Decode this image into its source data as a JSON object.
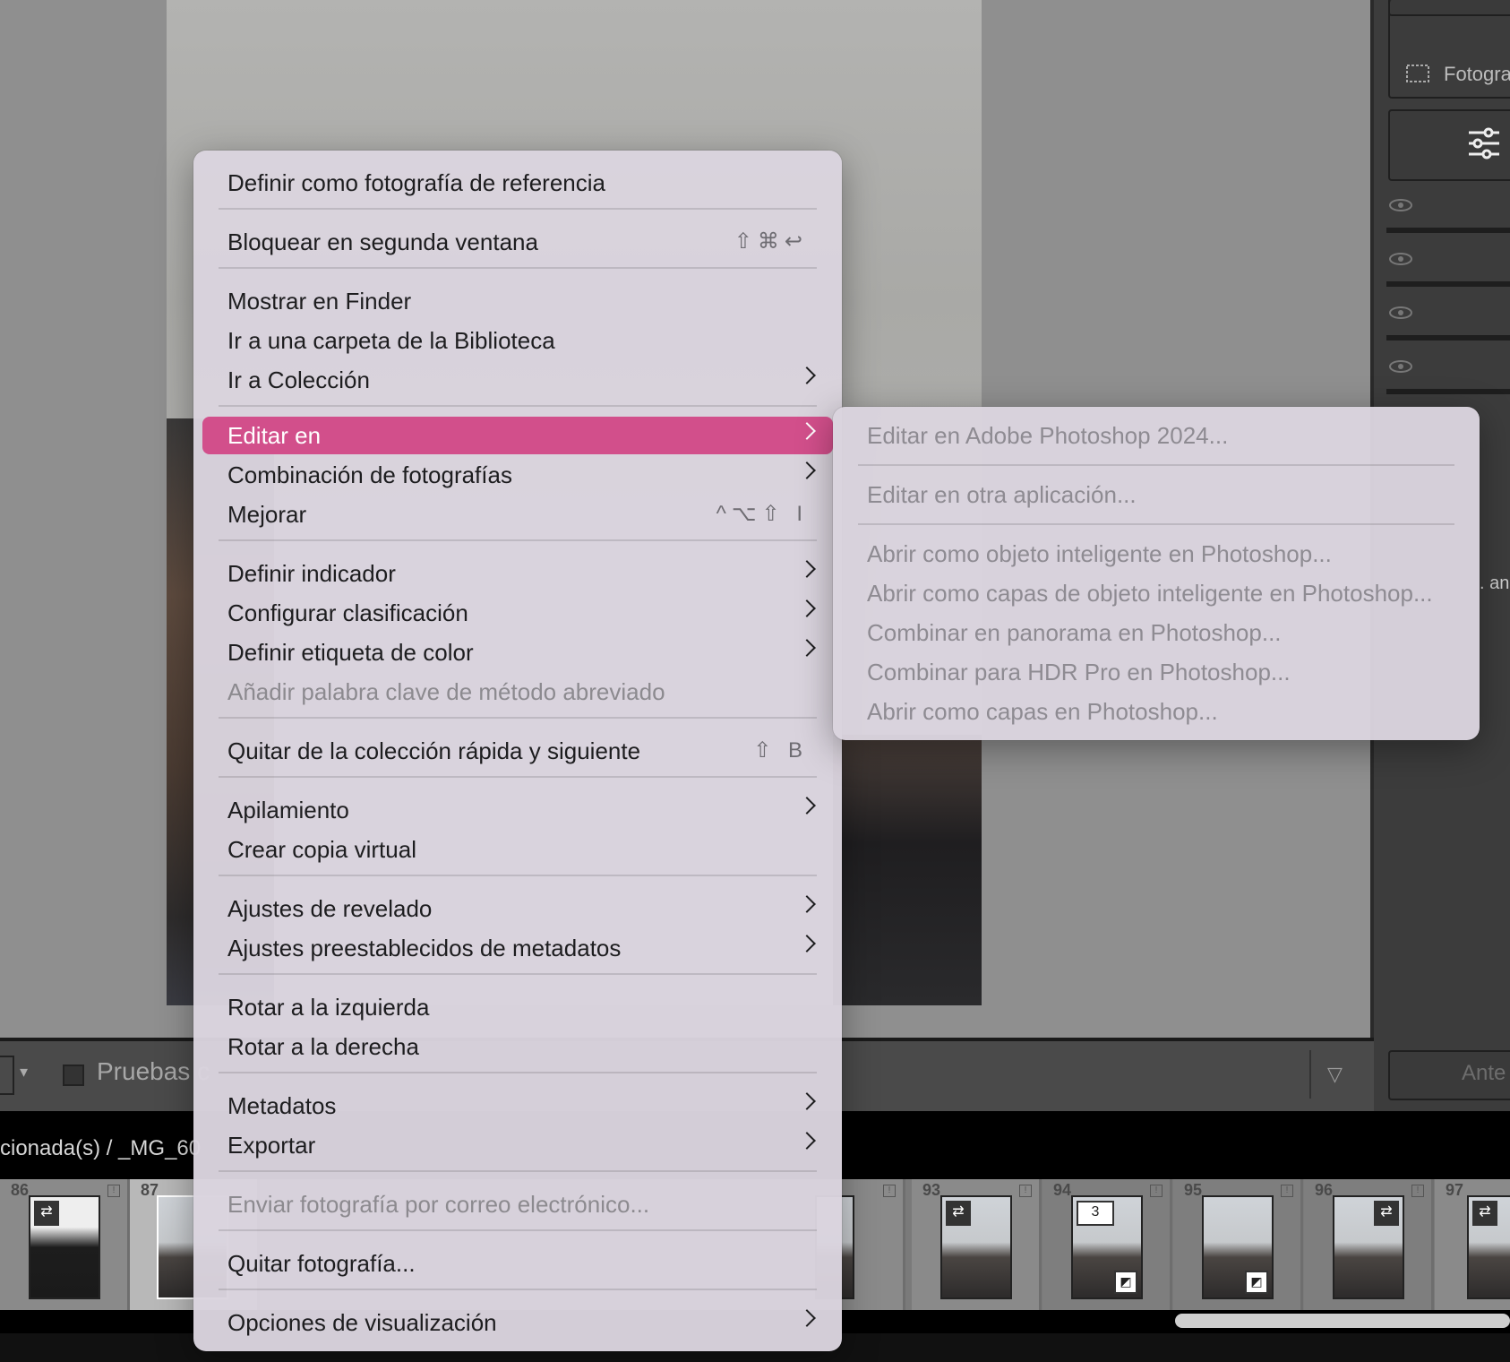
{
  "main_menu": {
    "items": [
      {
        "label": "Definir como fotografía de referencia"
      },
      {
        "label": "Bloquear en segunda ventana",
        "shortcut": "⇧⌘↩"
      },
      {
        "label": "Mostrar en Finder"
      },
      {
        "label": "Ir a una carpeta de la Biblioteca"
      },
      {
        "label": "Ir a Colección"
      },
      {
        "label": "Editar en"
      },
      {
        "label": "Combinación de fotografías"
      },
      {
        "label": "Mejorar",
        "shortcut": "^⌥⇧ I"
      },
      {
        "label": "Definir indicador"
      },
      {
        "label": "Configurar clasificación"
      },
      {
        "label": "Definir etiqueta de color"
      },
      {
        "label": "Añadir palabra clave de método abreviado"
      },
      {
        "label": "Quitar de la colección rápida y siguiente",
        "shortcut": "⇧ B"
      },
      {
        "label": "Apilamiento"
      },
      {
        "label": "Crear copia virtual"
      },
      {
        "label": "Ajustes de revelado"
      },
      {
        "label": "Ajustes preestablecidos de metadatos"
      },
      {
        "label": "Rotar a la izquierda"
      },
      {
        "label": "Rotar a la derecha"
      },
      {
        "label": "Metadatos"
      },
      {
        "label": "Exportar"
      },
      {
        "label": "Enviar fotografía por correo electrónico..."
      },
      {
        "label": "Quitar fotografía..."
      },
      {
        "label": "Opciones de visualización"
      }
    ]
  },
  "sub_menu": {
    "items": [
      {
        "label": "Editar en Adobe Photoshop 2024..."
      },
      {
        "label": "Editar en otra aplicación..."
      },
      {
        "label": "Abrir como objeto inteligente en Photoshop..."
      },
      {
        "label": "Abrir como capas de objeto inteligente en Photoshop..."
      },
      {
        "label": "Combinar en panorama en Photoshop..."
      },
      {
        "label": "Combinar para HDR Pro en Photoshop..."
      },
      {
        "label": "Abrir como capas en Photoshop..."
      }
    ]
  },
  "toolbar": {
    "proof_label": "Pruebas c"
  },
  "strip": {
    "path_text": "cionada(s) / _MG_60"
  },
  "right_panel": {
    "photo_label": "Fotografía",
    "ante_label": "Ante",
    "an_label": ". an"
  },
  "filmstrip": {
    "cells": [
      {
        "num": "86",
        "badge": "⇄"
      },
      {
        "num": "87",
        "badge": ""
      },
      {
        "num": "",
        "badge": ""
      },
      {
        "num": "",
        "badge": ""
      },
      {
        "num": "",
        "badge": ""
      },
      {
        "num": "",
        "badge": ""
      },
      {
        "num": "",
        "badge": ""
      },
      {
        "num": "93",
        "badge": "⇄"
      },
      {
        "num": "94",
        "badge": "3"
      },
      {
        "num": "95",
        "badge": ""
      },
      {
        "num": "96",
        "badge": "⇄"
      },
      {
        "num": "97",
        "badge": "⇄"
      }
    ]
  },
  "colors": {
    "active_highlight": "#d24f8b",
    "menu_bg": "#dad4de"
  }
}
